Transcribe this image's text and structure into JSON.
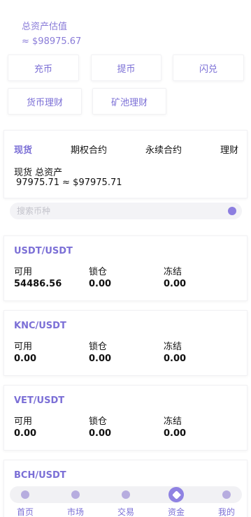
{
  "total": {
    "label": "总资产估值",
    "value": "≈ $98975.67"
  },
  "actions": {
    "charge": "充币",
    "withdraw": "提币",
    "flash": "闪兑",
    "wealth": "货币理财",
    "mining": "矿池理财"
  },
  "tabs": {
    "spot": "现货",
    "options": "期权合约",
    "perpetual": "永续合约",
    "finance": "理财"
  },
  "spot": {
    "title": "现货 总资产",
    "value": "97975.71 ≈ $97975.71"
  },
  "search": {
    "placeholder": "搜索币种"
  },
  "columns": {
    "available": "可用",
    "locked": "锁仓",
    "frozen": "冻结"
  },
  "assets": [
    {
      "pair": "USDT/USDT",
      "available": "54486.56",
      "locked": "0.00",
      "frozen": "0.00"
    },
    {
      "pair": "KNC/USDT",
      "available": "0.00",
      "locked": "0.00",
      "frozen": "0.00"
    },
    {
      "pair": "VET/USDT",
      "available": "0.00",
      "locked": "0.00",
      "frozen": "0.00"
    },
    {
      "pair": "BCH/USDT"
    }
  ],
  "nav": {
    "home": "首页",
    "market": "市场",
    "trade": "交易",
    "funds": "资金",
    "mine": "我的"
  },
  "colors": {
    "accent": "#7b6fd6",
    "card_border": "#f1f1f4"
  },
  "icons": {
    "home": "home-icon",
    "market": "bar-chart-icon",
    "trade": "exchange-icon",
    "funds": "heart-icon",
    "mine": "user-icon",
    "search": "search-icon"
  }
}
